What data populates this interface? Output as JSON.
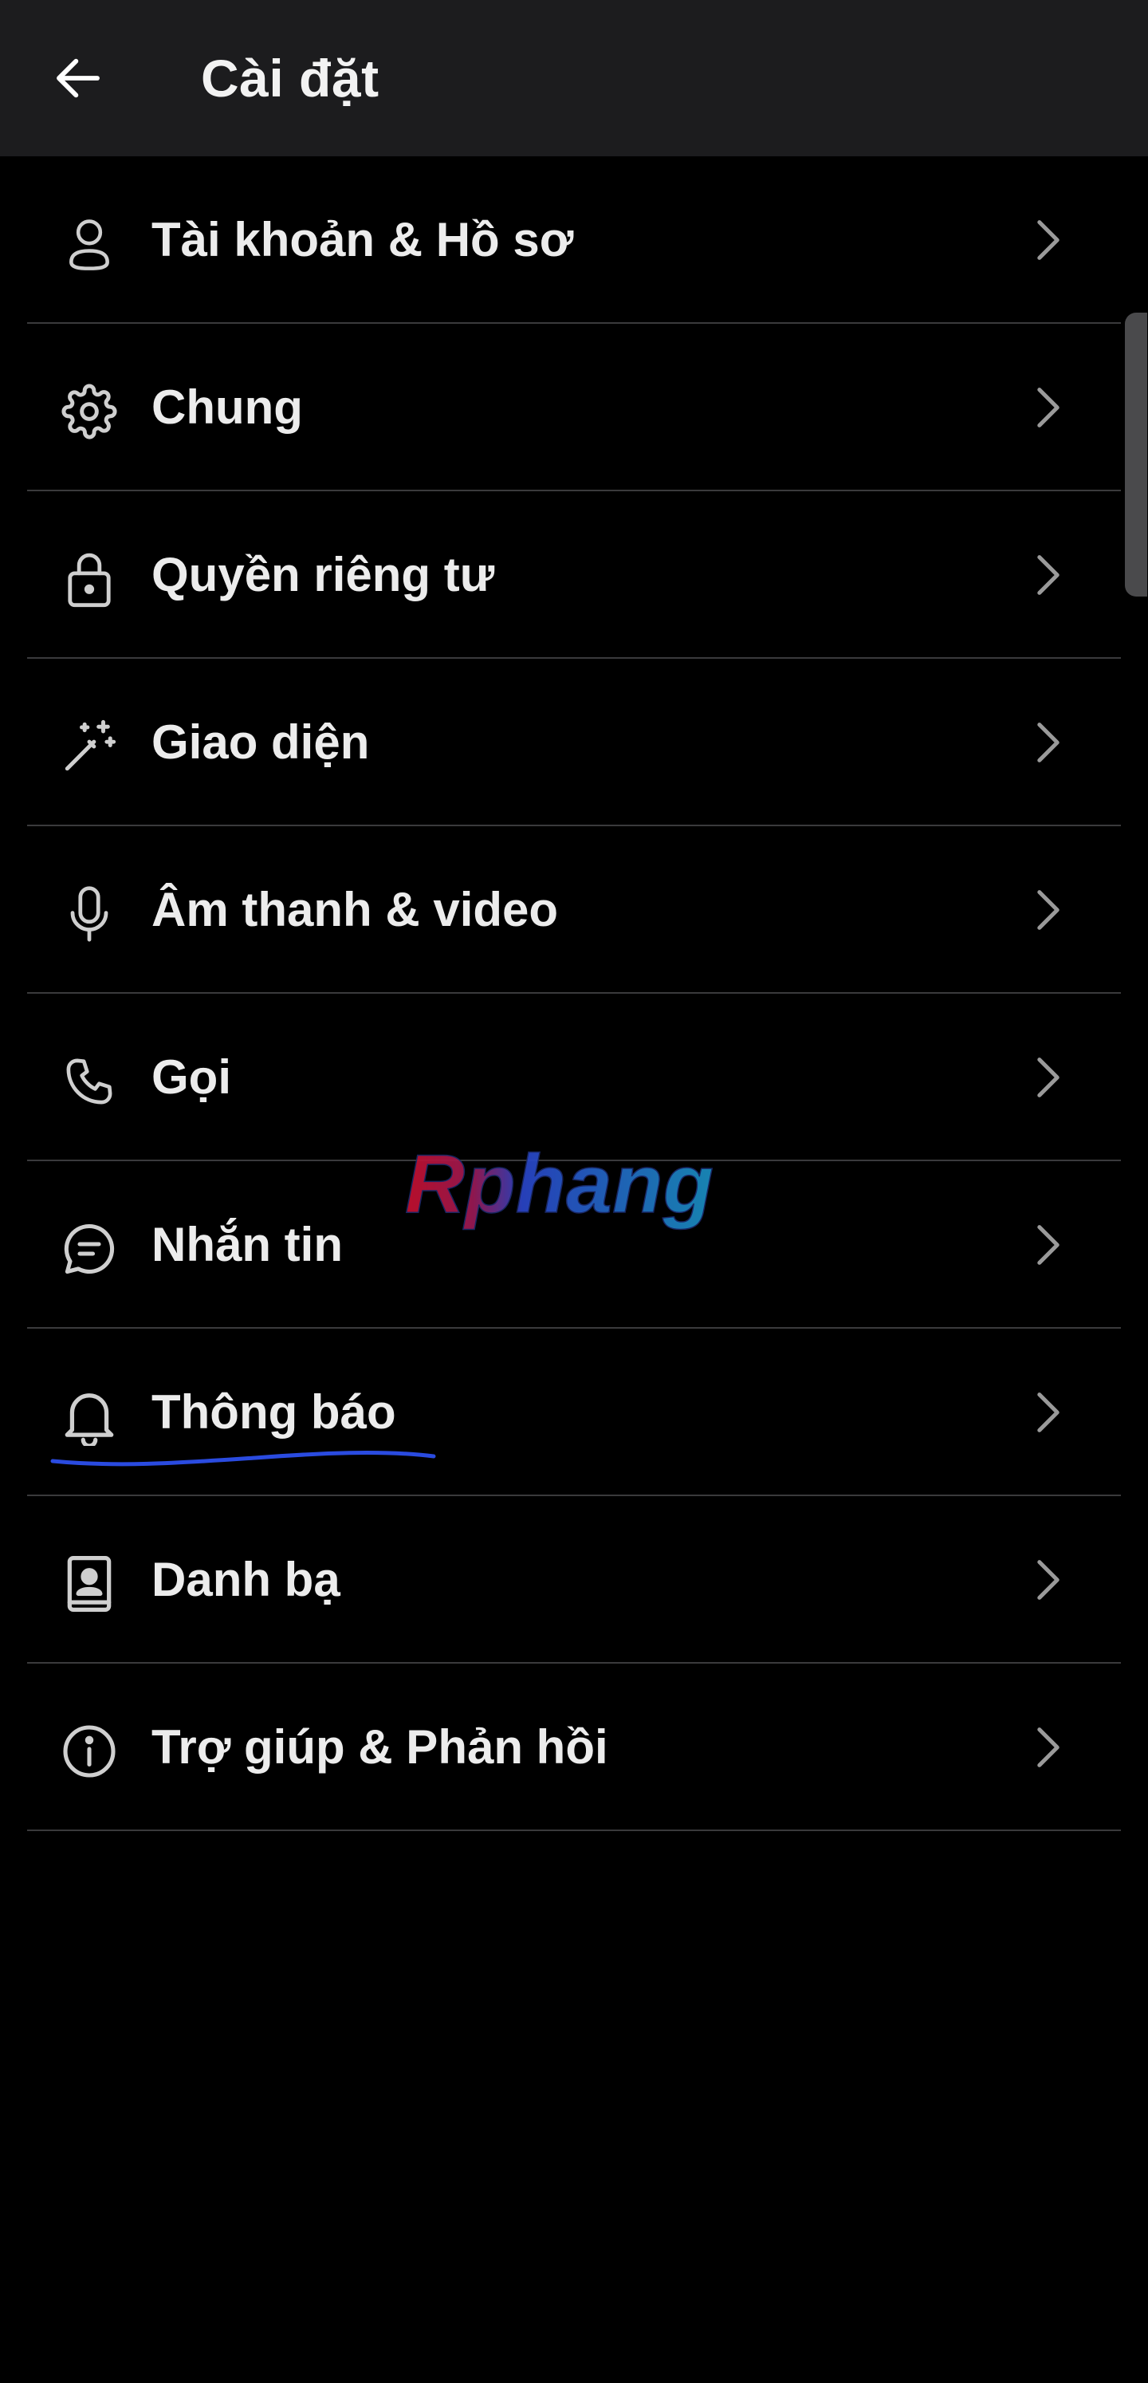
{
  "header": {
    "title": "Cài đặt",
    "back_icon": "arrow-left-icon"
  },
  "menu": {
    "items": [
      {
        "label": "Tài khoản & Hồ sơ",
        "icon": "person-icon"
      },
      {
        "label": "Chung",
        "icon": "gear-icon"
      },
      {
        "label": "Quyền riêng tư",
        "icon": "lock-icon"
      },
      {
        "label": "Giao diện",
        "icon": "magic-wand-icon"
      },
      {
        "label": "Âm thanh & video",
        "icon": "microphone-icon"
      },
      {
        "label": "Gọi",
        "icon": "phone-icon"
      },
      {
        "label": "Nhắn tin",
        "icon": "chat-bubble-icon"
      },
      {
        "label": "Thông báo",
        "icon": "bell-icon"
      },
      {
        "label": "Danh bạ",
        "icon": "contacts-book-icon"
      },
      {
        "label": "Trợ giúp & Phản hồi",
        "icon": "info-icon"
      }
    ],
    "chevron_icon": "chevron-right-icon"
  },
  "watermark": {
    "text": "Rphang"
  },
  "colors": {
    "background": "#000000",
    "header_bg": "#1c1c1e",
    "text": "#ececec",
    "divider": "#3a3a3c",
    "icon": "#cfcfcf",
    "chevron": "#9a9a9a",
    "annotation_underline": "#2a4be0",
    "watermark_red": "#c8102e",
    "watermark_blue": "#1a7fd0"
  }
}
